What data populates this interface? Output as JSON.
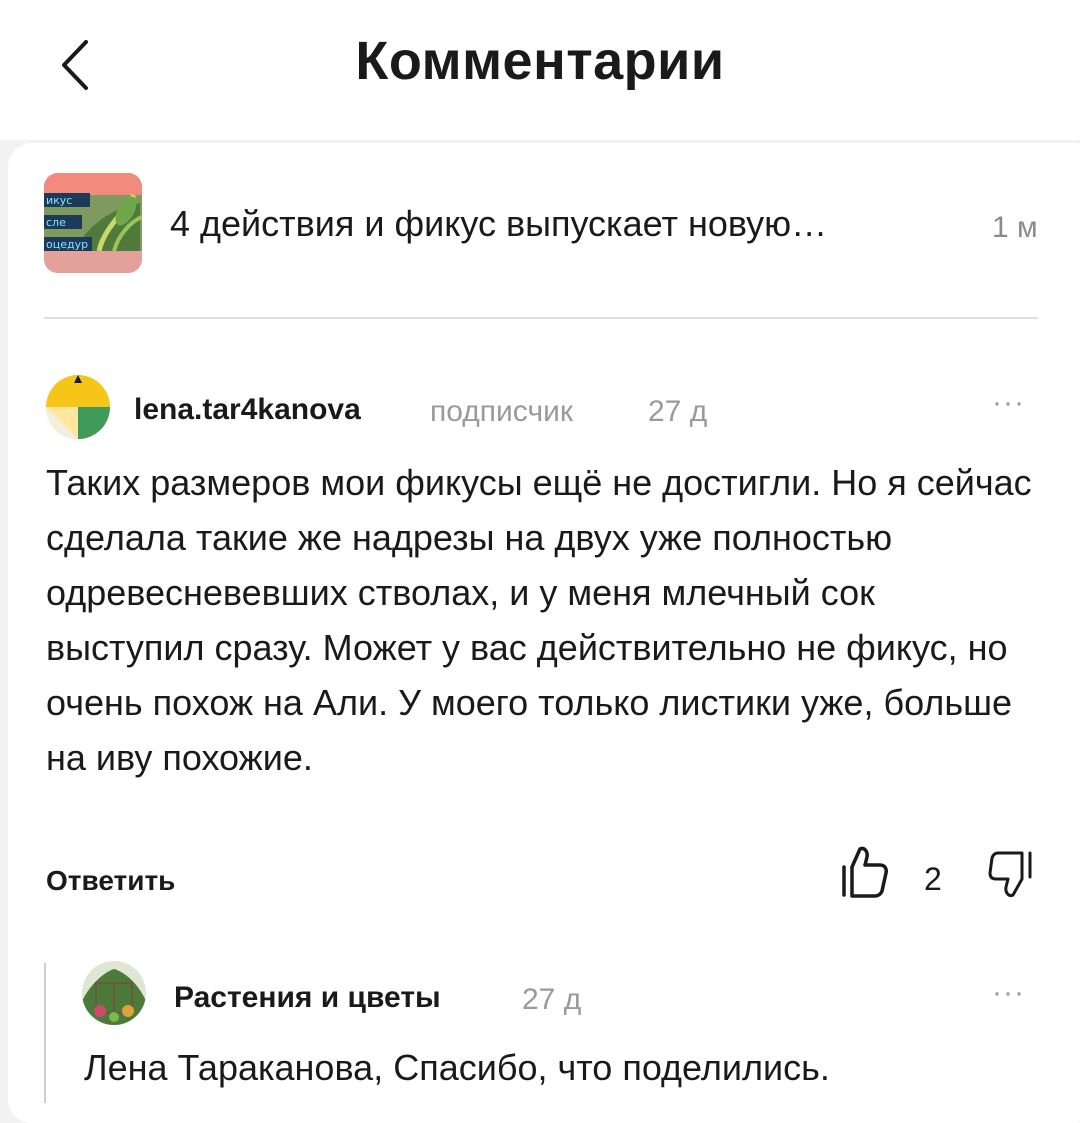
{
  "header": {
    "title": "Комментарии",
    "back_icon": "chevron-left-icon"
  },
  "article": {
    "title": "4 действия и фикус выпускает новую…",
    "time": "1 м",
    "thumb_overlay_lines": [
      "икус",
      "сле",
      "оцедур"
    ]
  },
  "comment": {
    "author": "lena.tar4kanova",
    "role": "подписчик",
    "time": "27 д",
    "text": "Таких размеров мои фикусы ещё не достигли. Но я сейчас сделала такие же надрезы на двух уже полностью одревесневевших стволах, и у меня млечный сок выступил сразу. Может у вас действительно не фикус, но очень похож на Али. У моего только листики уже, больше на иву похожие.",
    "more_label": "···",
    "reply_label": "Ответить",
    "like_count": "2",
    "like_icon": "thumb-up-icon",
    "dislike_icon": "thumb-down-icon"
  },
  "reply": {
    "author": "Растения и цветы",
    "time": "27 д",
    "more_label": "···",
    "text": "Лена Тараканова, Спасибо, что поделились."
  },
  "colors": {
    "page_background": "#f2f2f2",
    "card_background": "#ffffff",
    "primary_text": "#1a1a1a",
    "secondary_text": "#9a9a9a",
    "avatar_yellow": "#f5c518",
    "avatar_green": "#3f9b5a"
  }
}
